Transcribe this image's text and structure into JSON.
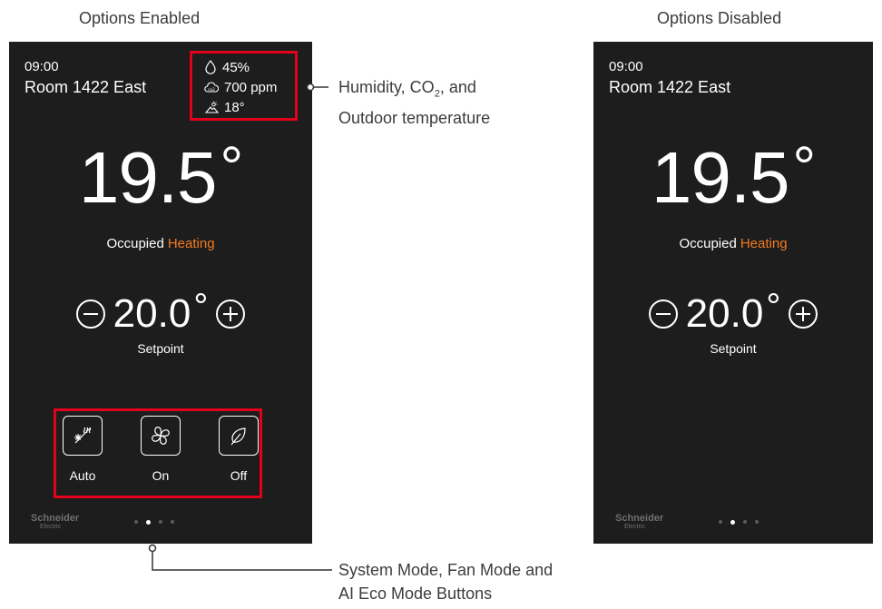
{
  "captions": {
    "left": "Options Enabled",
    "right": "Options Disabled"
  },
  "annotations": {
    "top_line1_prefix": "Humidity, CO",
    "top_line1_sub": "2",
    "top_line1_suffix": ", and",
    "top_line2": "Outdoor temperature",
    "bottom_line1": "System Mode, Fan Mode and",
    "bottom_line2": "AI Eco Mode Buttons"
  },
  "screens": {
    "enabled": {
      "time": "09:00",
      "room": "Room 1422 East",
      "humidity": "45%",
      "co2": "700 ppm",
      "co2_icon_label": "co2",
      "outdoor_temp": "18°",
      "temperature": "19.5",
      "temperature_unit": "°",
      "occupancy": "Occupied",
      "heating_state": "Heating",
      "setpoint_value": "20.0",
      "setpoint_unit": "°",
      "setpoint_label": "Setpoint",
      "modes": [
        {
          "label": "Auto",
          "icon": "auto-heat-cool-icon"
        },
        {
          "label": "On",
          "icon": "fan-icon"
        },
        {
          "label": "Off",
          "icon": "leaf-icon"
        }
      ],
      "logo": "Schneider",
      "logo_sub": "Electric",
      "page_dots": {
        "count": 4,
        "active": 2
      }
    },
    "disabled": {
      "time": "09:00",
      "room": "Room 1422 East",
      "temperature": "19.5",
      "temperature_unit": "°",
      "occupancy": "Occupied",
      "heating_state": "Heating",
      "setpoint_value": "20.0",
      "setpoint_unit": "°",
      "setpoint_label": "Setpoint",
      "logo": "Schneider",
      "logo_sub": "Electric",
      "page_dots": {
        "count": 4,
        "active": 2
      }
    }
  },
  "colors": {
    "screen_bg": "#1d1d1d",
    "heating": "#f47b20",
    "highlight_box": "#e2001a",
    "text": "#ffffff"
  }
}
